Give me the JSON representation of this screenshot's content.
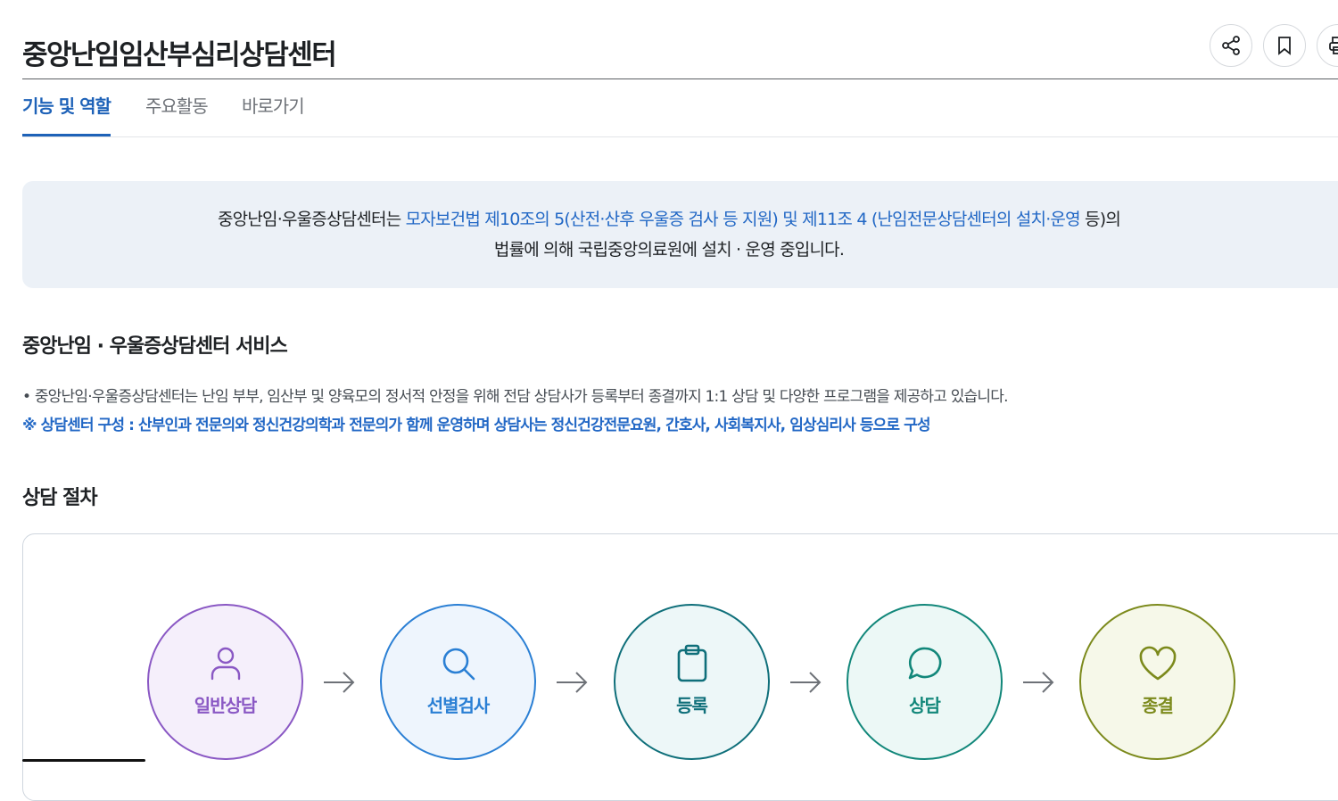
{
  "header": {
    "title": "중앙난임임산부심리상담센터",
    "actions": [
      {
        "name": "share-button",
        "icon": "share-icon"
      },
      {
        "name": "bookmark-button",
        "icon": "bookmark-icon"
      },
      {
        "name": "print-button",
        "icon": "print-icon"
      }
    ]
  },
  "tabs": [
    {
      "label": "기능 및 역할",
      "active": true
    },
    {
      "label": "주요활동",
      "active": false
    },
    {
      "label": "바로가기",
      "active": false
    }
  ],
  "intro": {
    "line1_prefix": "중앙난임·우울증상담센터는 ",
    "line1_link": "모자보건법 제10조의 5(산전·산후 우울증 검사 등 지원) 및 제11조 4 (난임전문상담센터의 설치·운영",
    "line1_suffix": " 등)의",
    "line2": "법률에 의해 국립중앙의료원에 설치 · 운영 중입니다."
  },
  "service": {
    "title": "중앙난임 · 우울증상담센터 서비스",
    "bullet": "• 중앙난임·우울증상담센터는 난임 부부, 임산부 및 양육모의 정서적 안정을 위해 전담 상담사가 등록부터 종결까지 1:1 상담 및 다양한 프로그램을 제공하고 있습니다.",
    "note": "※ 상담센터 구성 : 산부인과 전문의와 정신건강의학과 전문의가 함께 운영하며 상담사는 정신건강전문요원, 간호사, 사회복지사, 임상심리사 등으로 구성"
  },
  "process": {
    "title": "상담 절차",
    "steps": [
      {
        "label": "일반상담",
        "icon": "person-icon",
        "color": "#8a58c4",
        "bg": "#f5effb"
      },
      {
        "label": "선별검사",
        "icon": "search-icon",
        "color": "#2a7fd4",
        "bg": "#eef5fd"
      },
      {
        "label": "등록",
        "icon": "clipboard-icon",
        "color": "#0f6f7a",
        "bg": "#edf7f8"
      },
      {
        "label": "상담",
        "icon": "chat-icon",
        "color": "#12877a",
        "bg": "#ecf8f6"
      },
      {
        "label": "종결",
        "icon": "heart-icon",
        "color": "#7c8a1c",
        "bg": "#f6f8e9"
      }
    ]
  },
  "colors": {
    "accent": "#1e62b8",
    "link": "#2167c5",
    "intro_bg": "#ecf1f7"
  }
}
